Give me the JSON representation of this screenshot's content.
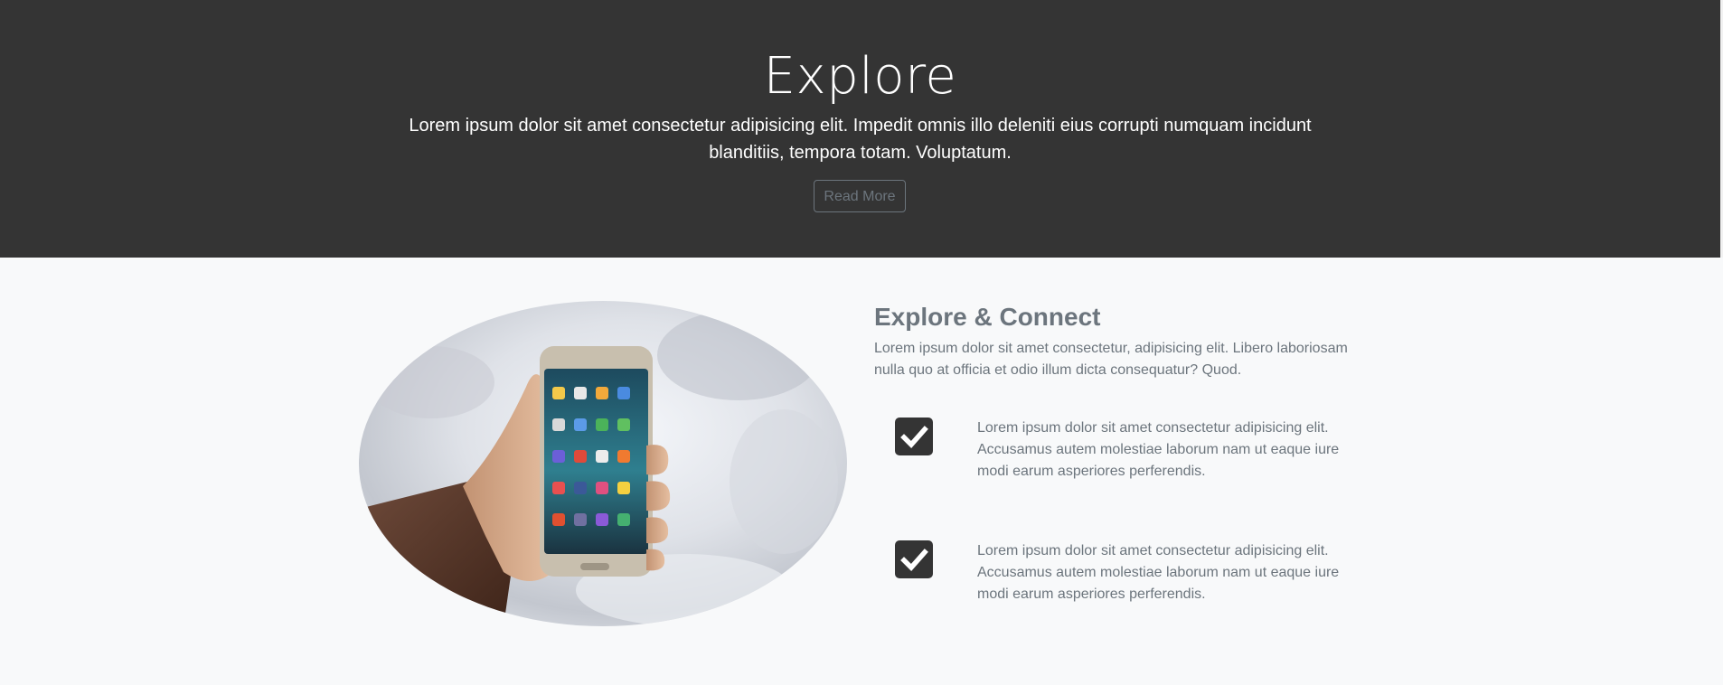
{
  "hero": {
    "title": "Explore",
    "text": "Lorem ipsum dolor sit amet consectetur adipisicing elit. Impedit omnis illo deleniti eius corrupti numquam incidunt blanditiis, tempora totam. Voluptatum.",
    "button_label": "Read More"
  },
  "feature": {
    "image_alt": "hand holding smartphone",
    "title": "Explore & Connect",
    "lead": "Lorem ipsum dolor sit amet consectetur, adipisicing elit. Libero laboriosam nulla quo at officia et odio illum dicta consequatur? Quod.",
    "items": [
      {
        "icon": "check-square-icon",
        "text": "Lorem ipsum dolor sit amet consectetur adipisicing elit. Accusamus autem molestiae laborum nam ut eaque iure modi earum asperiores perferendis."
      },
      {
        "icon": "check-square-icon",
        "text": "Lorem ipsum dolor sit amet consectetur adipisicing elit. Accusamus autem molestiae laborum nam ut eaque iure modi earum asperiores perferendis."
      }
    ]
  },
  "colors": {
    "hero_bg": "#343434",
    "section_bg": "#f8f9fa",
    "muted_text": "#6c757d"
  }
}
